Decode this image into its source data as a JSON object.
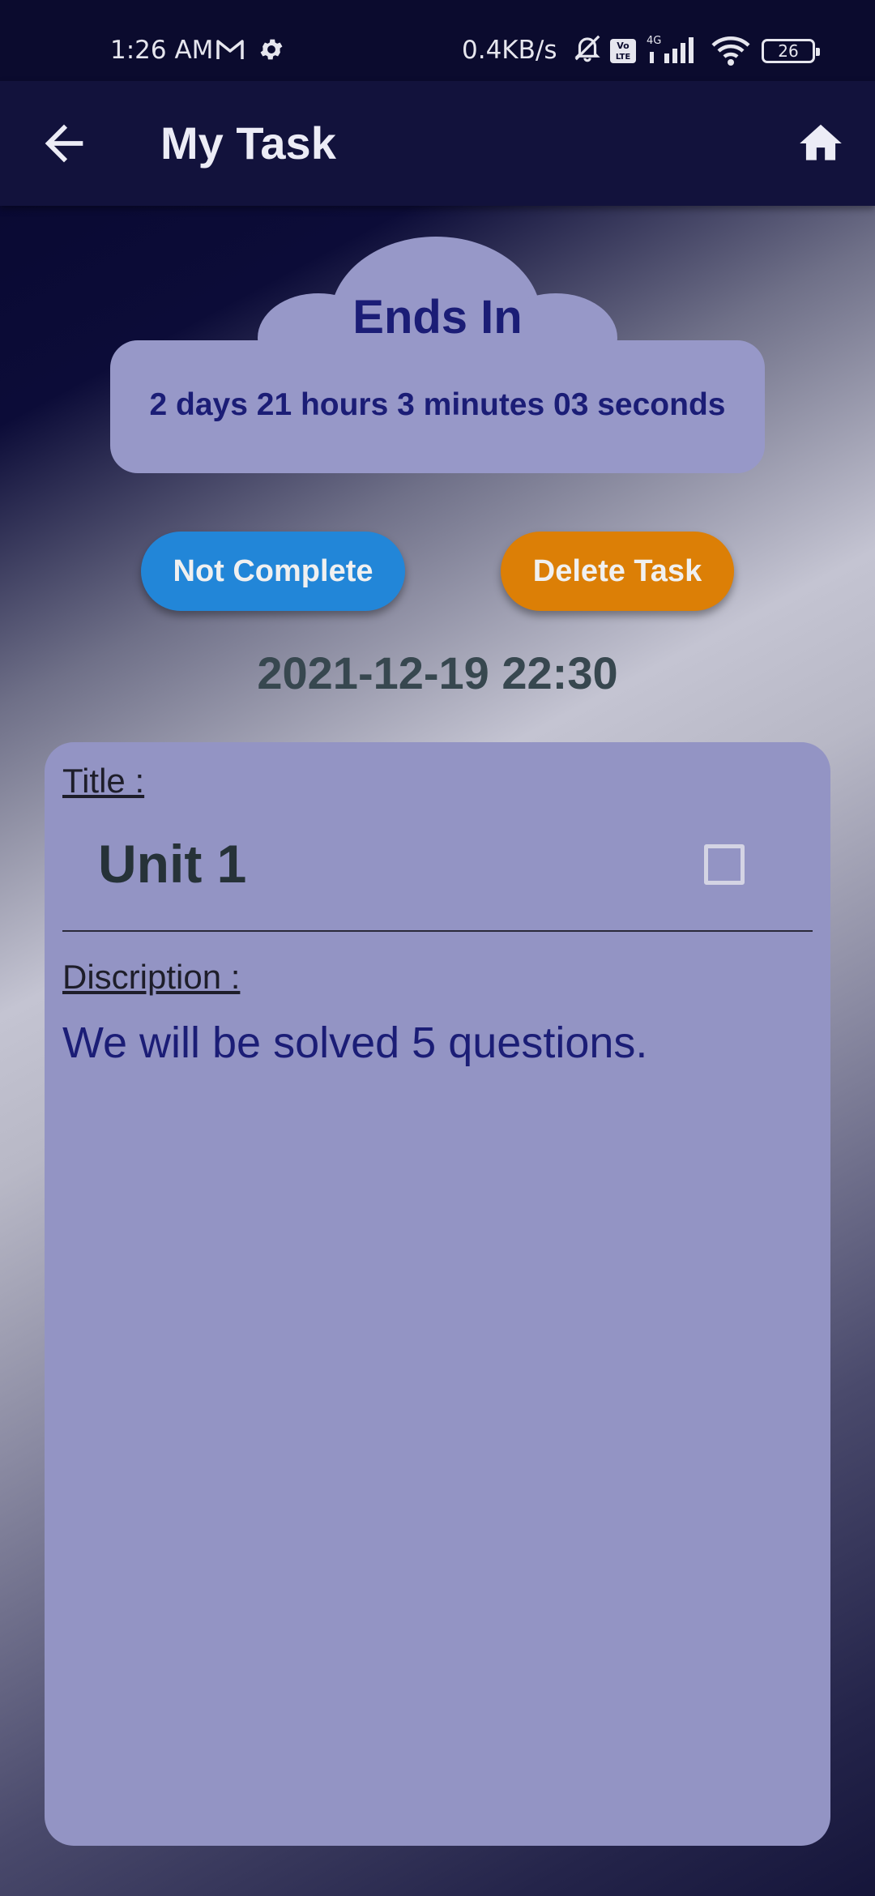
{
  "status_bar": {
    "time": "1:26 AM",
    "net_speed": "0.4KB/s",
    "volte": "Vo LTE",
    "network": "4G",
    "battery": "26",
    "icons": [
      "gmail-icon",
      "settings-icon",
      "mute-icon",
      "volte-icon",
      "signal-icon",
      "wifi-icon",
      "battery-icon"
    ]
  },
  "app_bar": {
    "title": "My Task",
    "back_icon": "arrow-left-icon",
    "home_icon": "home-icon"
  },
  "countdown": {
    "heading": "Ends In",
    "remaining": "2 days 21 hours 3 minutes 03 seconds"
  },
  "actions": {
    "not_complete_label": "Not Complete",
    "delete_label": "Delete Task"
  },
  "due_date": "2021-12-19 22:30",
  "task": {
    "title_label": "Title :",
    "title": "Unit 1",
    "completed": false,
    "description_label": "Discription :",
    "description": "We will be solved 5 questions."
  },
  "colors": {
    "app_bar": "#12123c",
    "card": "#9394c4",
    "cloud": "#9798c8",
    "not_complete_button": "#2286d8",
    "delete_button": "#dc7f06",
    "accent_text": "#1b1d76"
  }
}
